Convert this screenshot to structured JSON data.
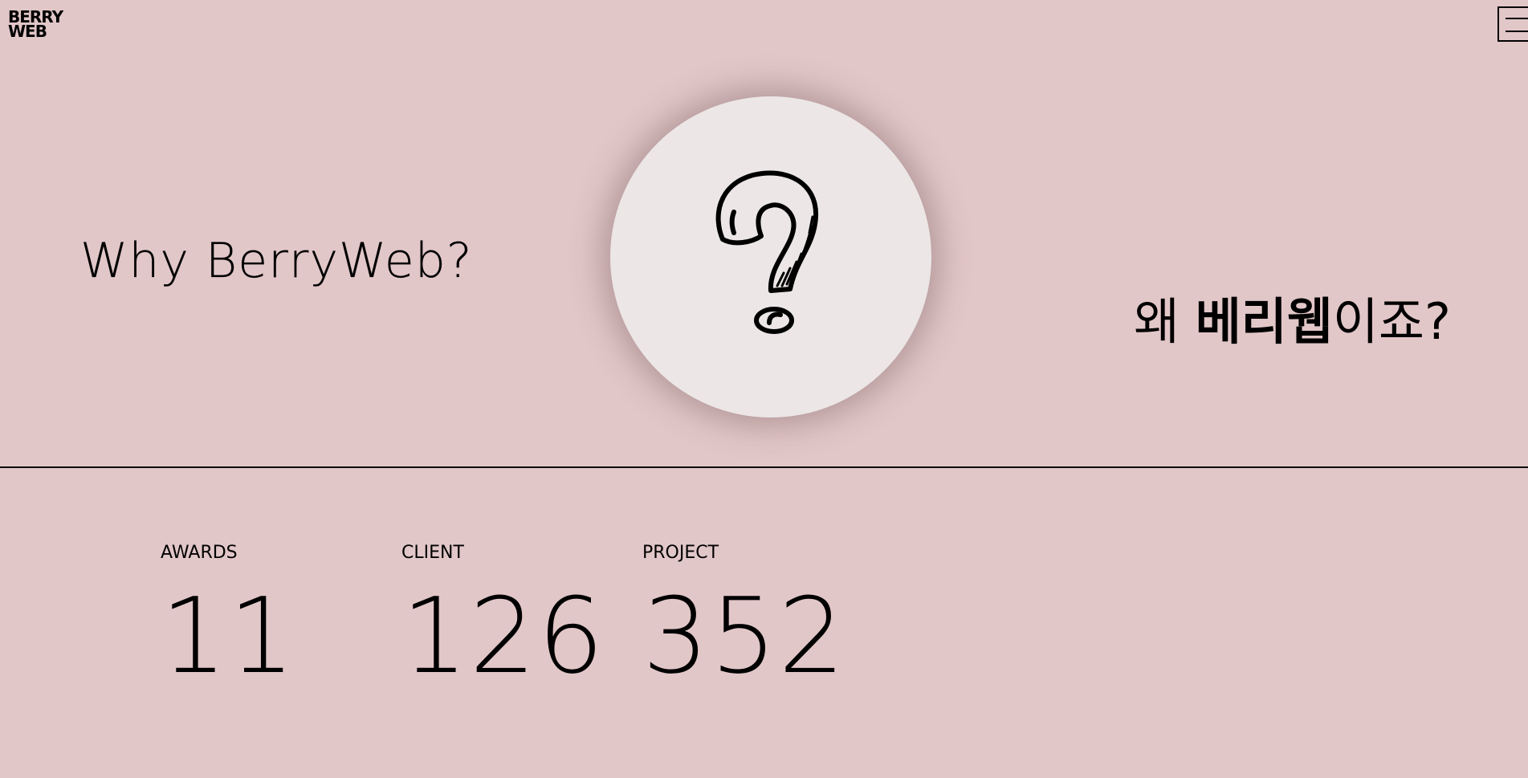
{
  "header": {
    "logo_line1": "BERRY",
    "logo_line2": "WEB",
    "menu_icon": "hamburger-menu-icon"
  },
  "hero": {
    "title_en": "Why BerryWeb?",
    "title_ko_prefix": "왜 ",
    "title_ko_bold": "베리웹",
    "title_ko_suffix": "이죠?",
    "center_icon": "question-mark-icon"
  },
  "stats": [
    {
      "label": "AWARDS",
      "value": "11"
    },
    {
      "label": "CLIENT",
      "value": "126"
    },
    {
      "label": "PROJECT",
      "value": "352"
    }
  ],
  "colors": {
    "background": "#e2c7c8",
    "circle": "#ece6e6",
    "text": "#000000"
  }
}
